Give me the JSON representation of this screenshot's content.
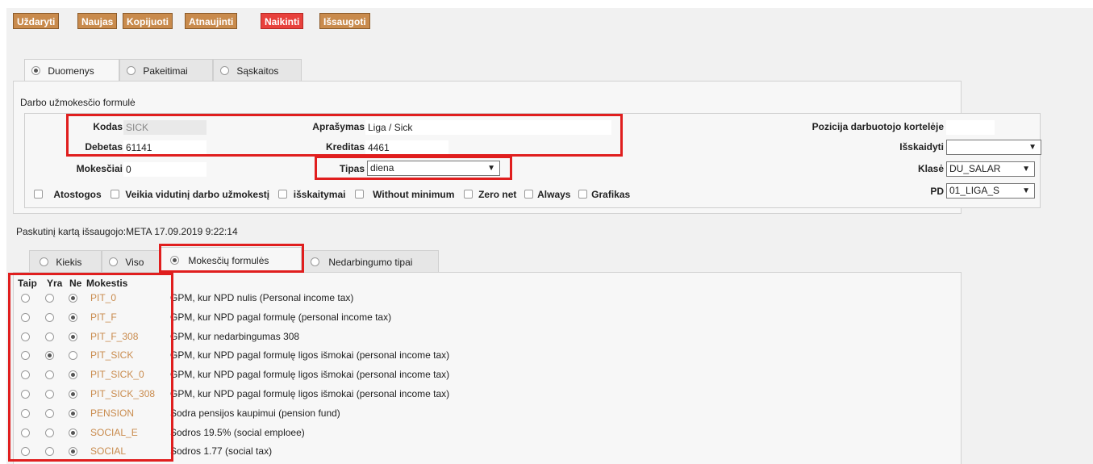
{
  "toolbar": {
    "buttons": [
      "Uždaryti",
      "Naujas",
      "Kopijuoti",
      "Atnaujinti",
      "Naikinti",
      "Išsaugoti"
    ]
  },
  "top_tabs": [
    "Duomenys",
    "Pakeitimai",
    "Sąskaitos"
  ],
  "section_title": "Darbo užmokesčio formulė",
  "form": {
    "kodas_label": "Kodas",
    "kodas_value": "SICK",
    "aprasymas_label": "Aprašymas",
    "aprasymas_value": "Liga / Sick",
    "pozicija_label": "Pozicija darbuotojo kortelėje",
    "pozicija_value": "",
    "debetas_label": "Debetas",
    "debetas_value": "61141",
    "kreditas_label": "Kreditas",
    "kreditas_value": "4461",
    "isskaidyti_label": "Išskaidyti",
    "isskaidyti_value": "",
    "mokesciai_label": "Mokesčiai",
    "mokesciai_value": "0",
    "tipas_label": "Tipas",
    "tipas_value": "diena",
    "klase_label": "Klasė",
    "klase_value": "DU_SALAR",
    "pd_label": "PD",
    "pd_value": "01_LIGA_S"
  },
  "checkboxes": [
    "Atostogos",
    "Veikia vidutinį darbo užmokestį",
    "išskaitymai",
    "Without minimum",
    "Zero net",
    "Always",
    "Grafikas"
  ],
  "last_saved": "Paskutinį kartą išsaugojo:META 17.09.2019 9:22:14",
  "sub_tabs": [
    "Kiekis",
    "Viso",
    "Mokesčių formulės",
    "Nedarbingumo tipai"
  ],
  "tax_table": {
    "headers": [
      "Taip",
      "Yra",
      "Ne",
      "Mokestis"
    ],
    "rows": [
      {
        "code": "PIT_0",
        "desc": "GPM, kur NPD nulis (Personal income tax)",
        "sel": 3
      },
      {
        "code": "PIT_F",
        "desc": "GPM, kur NPD pagal formulę (personal income tax)",
        "sel": 3
      },
      {
        "code": "PIT_F_308",
        "desc": "GPM, kur nedarbingumas 308",
        "sel": 3
      },
      {
        "code": "PIT_SICK",
        "desc": "GPM, kur NPD pagal formulę ligos išmokai (personal income tax)",
        "sel": 2
      },
      {
        "code": "PIT_SICK_0",
        "desc": "GPM, kur NPD pagal formulę ligos išmokai (personal income tax)",
        "sel": 3
      },
      {
        "code": "PIT_SICK_308",
        "desc": "GPM, kur NPD pagal formulę ligos išmokai (personal income tax)",
        "sel": 3
      },
      {
        "code": "PENSION",
        "desc": "Sodra pensijos kaupimui (pension fund)",
        "sel": 3
      },
      {
        "code": "SOCIAL_E",
        "desc": "Sodros 19.5% (social emploee)",
        "sel": 3
      },
      {
        "code": "SOCIAL",
        "desc": "Sodros 1.77 (social tax)",
        "sel": 3
      }
    ]
  },
  "colors": {
    "button": "#c98b4d",
    "delete_button": "#e8413c",
    "highlight": "#e01e1e",
    "code_link": "#c98b4d"
  }
}
